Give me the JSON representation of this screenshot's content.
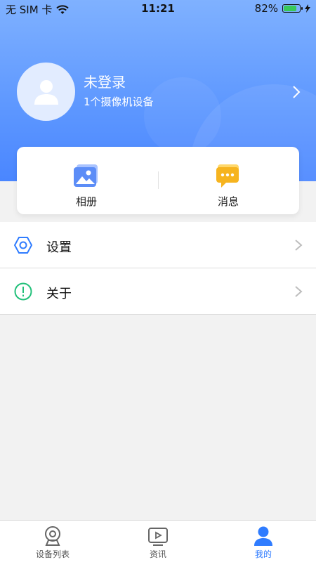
{
  "status_bar": {
    "carrier": "无 SIM 卡",
    "time": "11:21",
    "battery": "82%",
    "battery_level": 0.82
  },
  "profile": {
    "username": "未登录",
    "device_count": "1个摄像机设备"
  },
  "quick_actions": [
    {
      "label": "相册",
      "icon": "album-icon"
    },
    {
      "label": "消息",
      "icon": "message-icon"
    }
  ],
  "menu": [
    {
      "label": "设置",
      "icon": "settings-icon"
    },
    {
      "label": "关于",
      "icon": "about-icon"
    }
  ],
  "tabbar": {
    "tabs": [
      {
        "label": "设备列表",
        "icon": "camera-icon"
      },
      {
        "label": "资讯",
        "icon": "video-icon"
      },
      {
        "label": "我的",
        "icon": "user-icon"
      }
    ],
    "active": "我的"
  },
  "colors": {
    "header_gradient_top": "#7fb1ff",
    "header_gradient_bottom": "#4a86ff",
    "active_tab": "#2f7cff",
    "settings_icon": "#2f7cff",
    "about_icon": "#22c07a",
    "message_icon": "#f6b41f"
  }
}
